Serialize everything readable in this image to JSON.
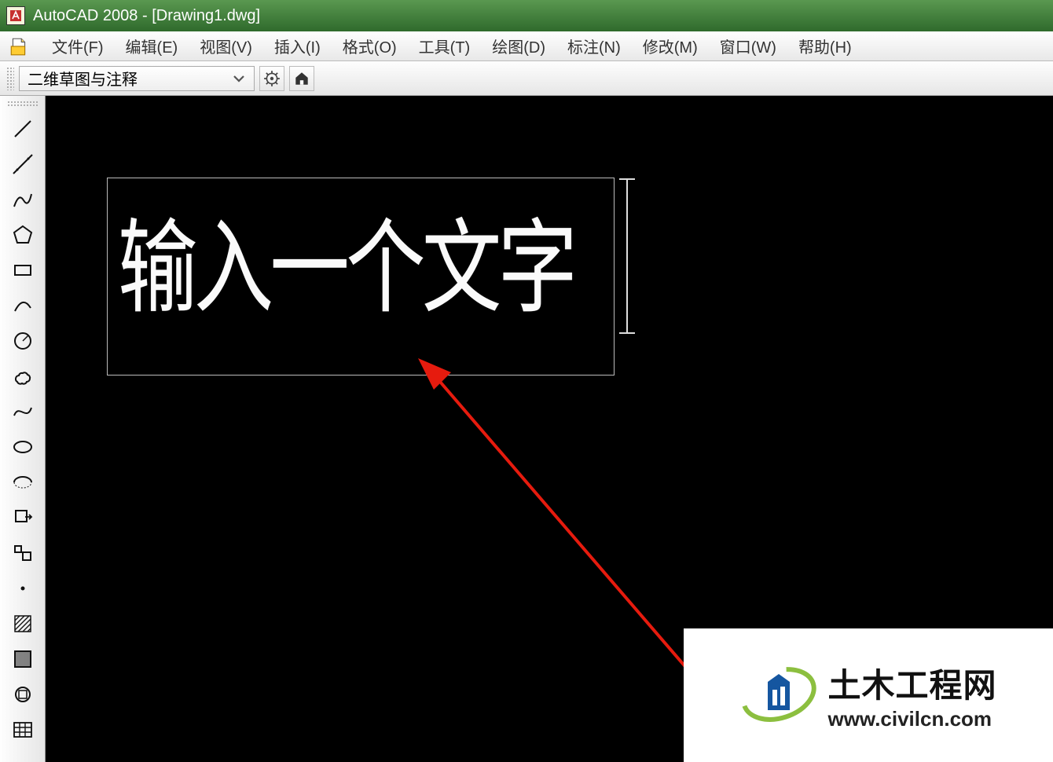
{
  "titlebar": {
    "title": "AutoCAD 2008 - [Drawing1.dwg]"
  },
  "menu": {
    "items": [
      "文件(F)",
      "编辑(E)",
      "视图(V)",
      "插入(I)",
      "格式(O)",
      "工具(T)",
      "绘图(D)",
      "标注(N)",
      "修改(M)",
      "窗口(W)",
      "帮助(H)"
    ]
  },
  "workspace": {
    "selected": "二维草图与注释"
  },
  "tools": [
    "line",
    "construction-line",
    "polyline",
    "polygon",
    "rectangle",
    "arc",
    "circle",
    "revision-cloud",
    "spline",
    "ellipse",
    "ellipse-arc",
    "insert-block",
    "make-block",
    "point",
    "hatch",
    "gradient",
    "region",
    "table"
  ],
  "canvas": {
    "text_input": "输入一个文字"
  },
  "watermark": {
    "title": "土木工程网",
    "url": "www.civilcn.com"
  }
}
